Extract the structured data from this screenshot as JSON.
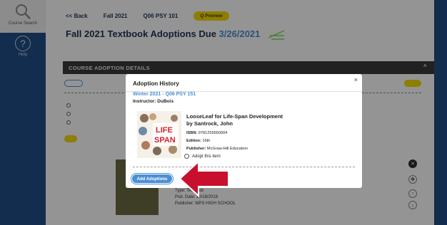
{
  "sidebar": {
    "search_label": "Course Search",
    "help_label": "Help"
  },
  "topnav": {
    "back": "<< Back",
    "term": "Fall 2021",
    "course": "Q06 PSY 101",
    "preview": "Q Preview"
  },
  "page": {
    "title": "Fall 2021 Textbook Adoptions Due ",
    "due_date": "3/26/2021"
  },
  "section": {
    "title": "COURSE ADOPTION DETAILS"
  },
  "background_item": {
    "type_line": "Type: Textbook",
    "pub_date_line": "Pub. Date: 10/18/2018",
    "publisher_line": "Publisher: MPS HIGH SCHOOL"
  },
  "modal": {
    "title": "Adoption History",
    "close": "×",
    "course_link": "Winter 2021 - Q06 PSY 151",
    "instructor": "Instructor: DuBois",
    "book": {
      "title_line1": "LooseLeaf for Life-Span Development",
      "title_line2": "by Santrock, John",
      "isbn_label": "ISBN:",
      "isbn": "9781259550904",
      "edition_label": "Edition:",
      "edition": "16th",
      "publisher_label": "Publisher:",
      "publisher": "McGraw-Hill Education",
      "cover_text_life": "LIFE",
      "cover_text_span": "SPAN"
    },
    "adopt_label": "Adopt this item",
    "add_button": "Add Adoptions"
  },
  "colors": {
    "sidebar_blue": "#1f4f86",
    "accent_blue": "#4a8fd4",
    "preview_yellow": "#f4d900",
    "arrow_red": "#c8102e"
  }
}
